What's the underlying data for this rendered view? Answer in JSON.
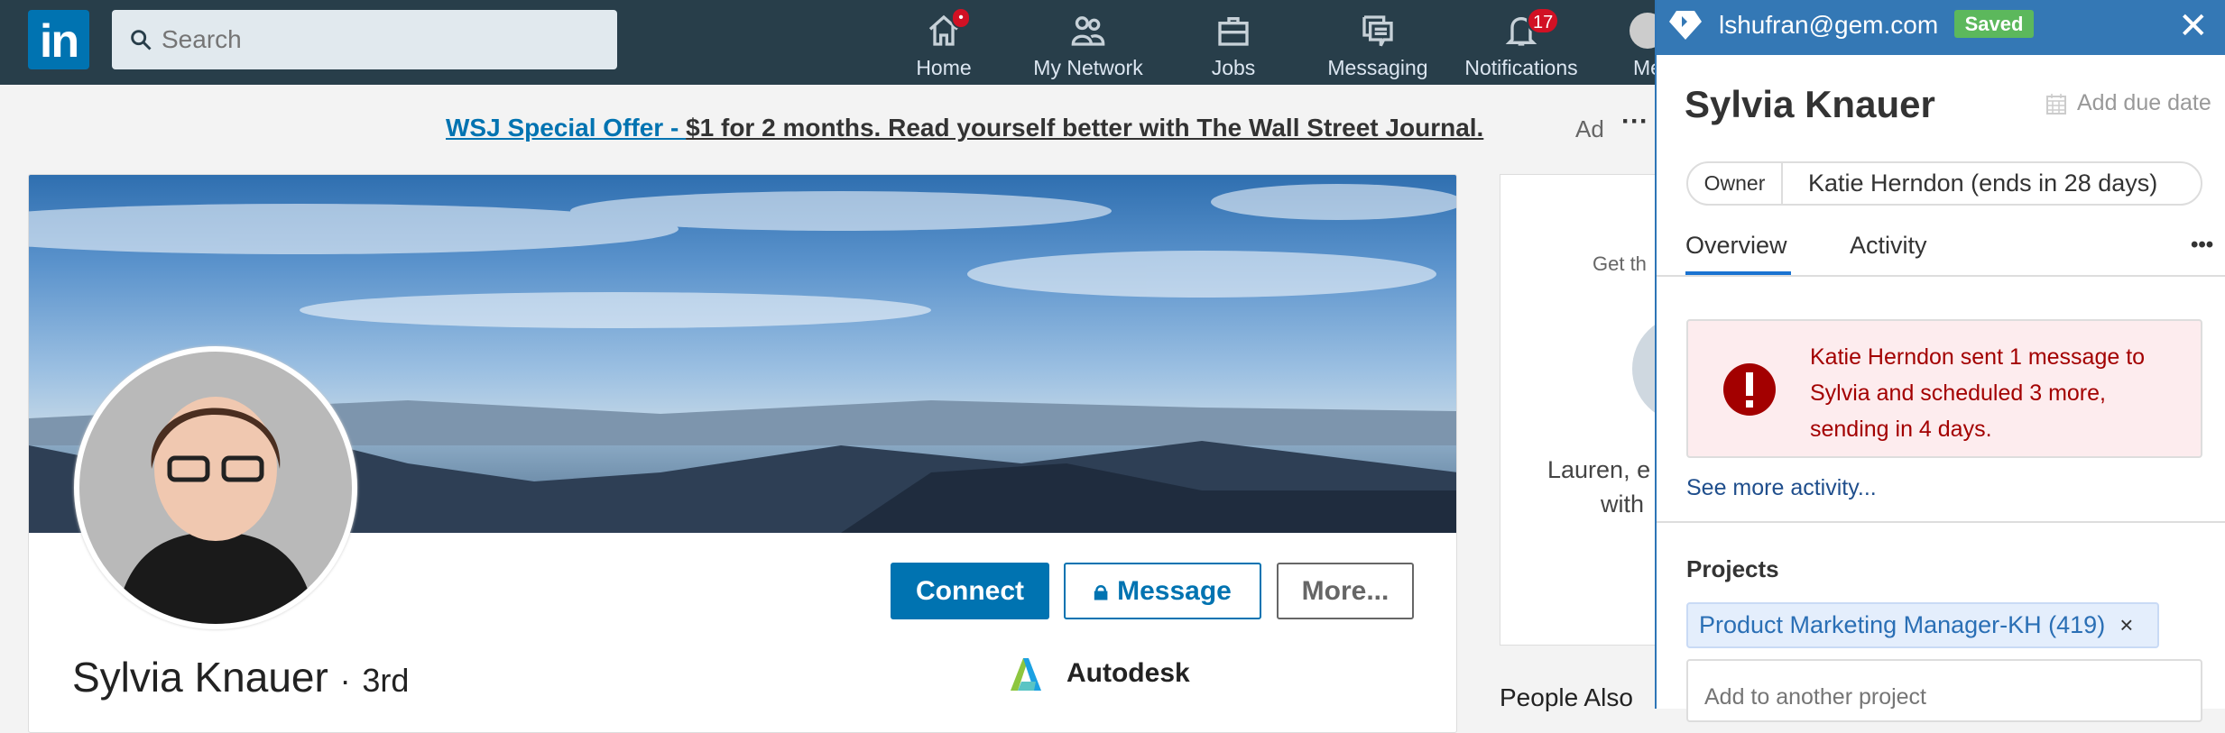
{
  "nav": {
    "logo": "in",
    "search_placeholder": "Search",
    "items": [
      {
        "label": "Home",
        "icon": "home-icon",
        "badge": "•"
      },
      {
        "label": "My Network",
        "icon": "network-icon"
      },
      {
        "label": "Jobs",
        "icon": "briefcase-icon"
      },
      {
        "label": "Messaging",
        "icon": "messaging-icon"
      },
      {
        "label": "Notifications",
        "icon": "bell-icon",
        "badge": "17"
      },
      {
        "label": "Me",
        "icon": "avatar-icon"
      }
    ]
  },
  "ad": {
    "link": "WSJ Special Offer - ",
    "text": "$1 for 2 months. Read yourself better with The Wall Street Journal.",
    "label": "Ad",
    "more": "···"
  },
  "profile": {
    "name": "Sylvia Knauer",
    "separator": "·",
    "degree": "3rd",
    "company": "Autodesk",
    "buttons": {
      "connect": "Connect",
      "message": "Message",
      "more": "More..."
    }
  },
  "side": {
    "text1": "Get th",
    "text2": "Lauren, e",
    "text3": "with",
    "people_also": "People Also"
  },
  "panel": {
    "email": "lshufran@gem.com",
    "status": "Saved",
    "name": "Sylvia Knauer",
    "due_date": "Add due date",
    "owner_label": "Owner",
    "owner_value": "Katie Herndon (ends in 28 days)",
    "tabs": [
      "Overview",
      "Activity"
    ],
    "more": "•••",
    "alert": "Katie Herndon sent 1 message to Sylvia and scheduled 3 more, sending in 4 days.",
    "see_more": "See more activity...",
    "projects_heading": "Projects",
    "project_chip": "Product Marketing Manager-KH (419)",
    "chip_remove": "×",
    "add_project_placeholder": "Add to another project"
  },
  "colors": {
    "nav": "#283e4a",
    "linkedin_blue": "#0073b1",
    "gem_header": "#3478b5",
    "saved": "#5cb85c",
    "alert_text": "#a30000",
    "alert_bg": "#fdecee"
  }
}
